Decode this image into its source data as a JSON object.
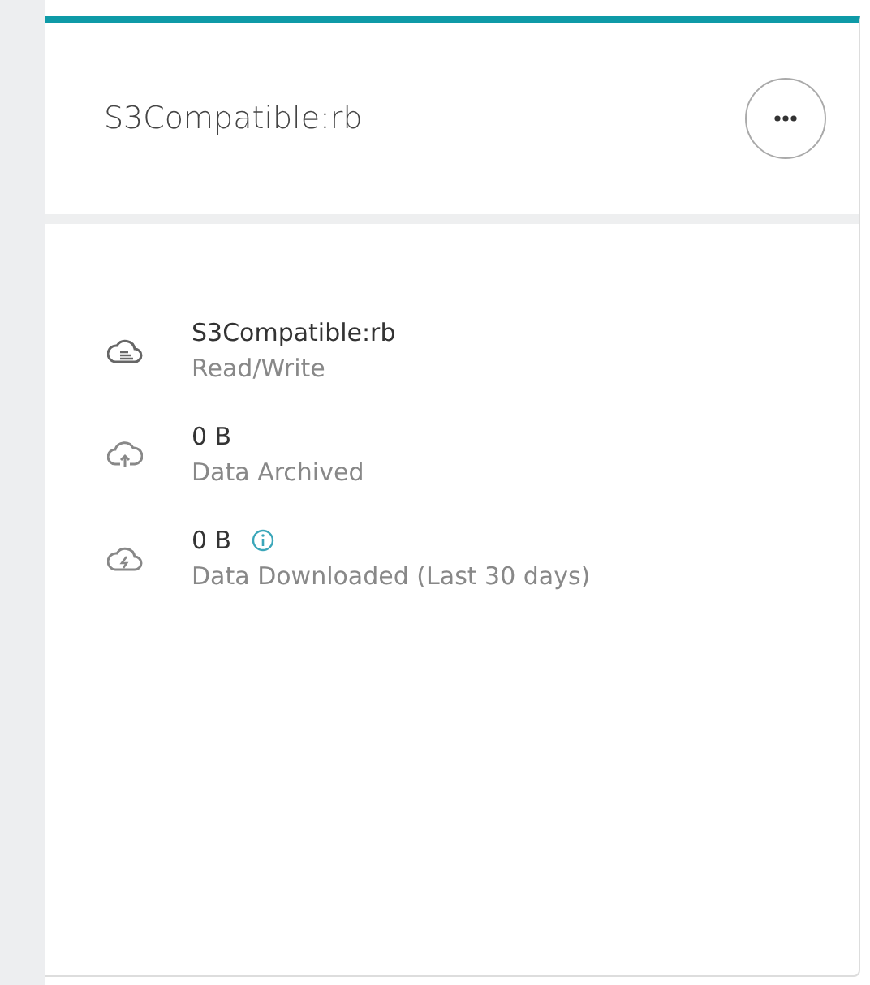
{
  "card": {
    "title": "S3Compatible:rb",
    "items": [
      {
        "kind": "storage",
        "value": "S3Compatible:rb",
        "label": "Read/Write",
        "info": false
      },
      {
        "kind": "upload",
        "value": "0 B",
        "label": "Data Archived",
        "info": false
      },
      {
        "kind": "download",
        "value": "0 B",
        "label": "Data Downloaded (Last 30 days)",
        "info": true
      }
    ]
  }
}
